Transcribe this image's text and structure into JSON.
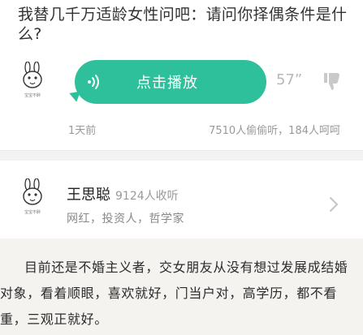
{
  "question": {
    "text": "我替几千万适龄女性问吧：请问你择偶条件是什么?"
  },
  "voice": {
    "play_label": "点击播放",
    "duration": "57”"
  },
  "meta": {
    "time": "1天前",
    "stats": "7510人偷偷听，184人呵呵"
  },
  "avatar": {
    "caption": "宝宝不醉"
  },
  "profile": {
    "name": "王思聪",
    "followers": "9124人收听",
    "tags": "网红，投资人，哲学家"
  },
  "answer": {
    "text": "目前还是不婚主义者，交女朋友从没有想过发展成结婚对象，看着顺眼，喜欢就好，门当户对，高学历，都不看重，三观正就好。"
  },
  "colors": {
    "bubble": "#2dc09a",
    "answer_bg": "#f4f3ef",
    "muted": "#999999"
  },
  "icons": [
    "rabbit-avatar-icon",
    "sound-wave-icon",
    "thumbs-down-icon",
    "chevron-right-icon"
  ]
}
